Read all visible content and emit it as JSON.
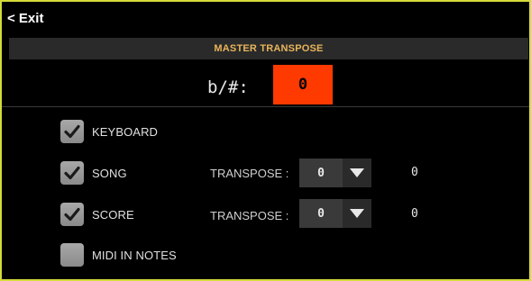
{
  "header": {
    "exit_label": "< Exit"
  },
  "master": {
    "title": "MASTER TRANSPOSE",
    "label": "b/#:",
    "value": "0"
  },
  "options": {
    "keyboard": {
      "label": "KEYBOARD",
      "checked": true
    },
    "song": {
      "label": "SONG",
      "checked": true,
      "transpose_label": "TRANSPOSE :",
      "transpose_value": "0",
      "readout": "0"
    },
    "score": {
      "label": "SCORE",
      "checked": true,
      "transpose_label": "TRANSPOSE :",
      "transpose_value": "0",
      "readout": "0"
    },
    "midi_in_notes": {
      "label": "MIDI IN NOTES",
      "checked": false
    }
  },
  "colors": {
    "frame_border": "#d4db3a",
    "accent_value_box": "#ff3a00",
    "section_title": "#e8b45a",
    "checkbox_fill": "#9a9a9a",
    "check_mark": "#1a1a1a"
  },
  "icons": {
    "check": "check-icon",
    "dropdown": "triangle-down-icon"
  }
}
